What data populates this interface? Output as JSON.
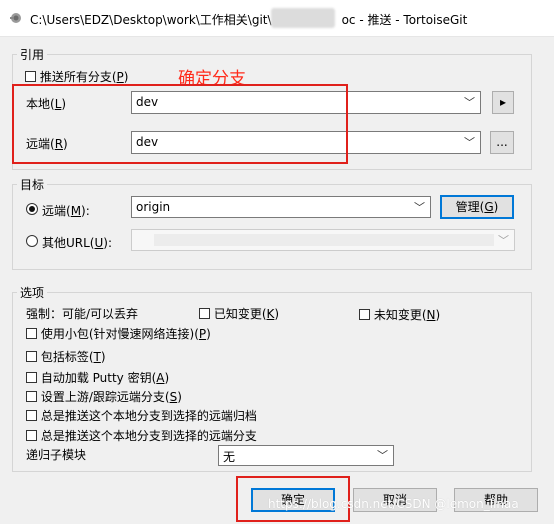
{
  "window": {
    "title_left": "C:\\Users\\EDZ\\Desktop\\work\\工作相关\\git\\",
    "title_right": "oc - 推送 - TortoiseGit"
  },
  "ref_group": {
    "legend": "引用",
    "push_all_label": "推送所有分支(",
    "push_all_key": "P",
    "local_label": "本地(",
    "local_key": "L",
    "local_value": "dev",
    "remote_label": "远端(",
    "remote_key": "R",
    "remote_value": "dev",
    "arrow_button": "▸",
    "more_button": "..."
  },
  "annotation": "确定分支",
  "target_group": {
    "legend": "目标",
    "remote_label": "远端(",
    "remote_key": "M",
    "remote_value": "origin",
    "manage_label": "管理(",
    "manage_key": "G",
    "other_url_label": "其他URL(",
    "other_url_key": "U"
  },
  "options_group": {
    "legend": "选项",
    "force_label": "强制：可能/可以丢弃",
    "known_changes_label": "已知变更(",
    "known_changes_key": "K",
    "unknown_changes_label": "未知变更(",
    "unknown_changes_key": "N",
    "thin_pack_label": "使用小包(针对慢速网络连接)(",
    "thin_pack_key": "P",
    "include_tags_label": "包括标签(",
    "include_tags_key": "T",
    "autoload_putty_label": "自动加载 Putty 密钥(",
    "autoload_putty_key": "A",
    "set_upstream_label": "设置上游/跟踪远端分支(",
    "set_upstream_key": "S",
    "always_push_archive": "总是推送这个本地分支到选择的远端归档",
    "always_push_branch": "总是推送这个本地分支到选择的远端分支",
    "recurse_submodules_label": "递归子模块",
    "recurse_submodules_value": "无"
  },
  "buttons": {
    "ok": "确定",
    "cancel": "取消",
    "help": "帮助"
  },
  "watermark": "https://blog.csdn.net/CSDN @lemon_linaa",
  "colors": {
    "annotation_red": "#e0201b",
    "default_button_border": "#0078d7"
  }
}
